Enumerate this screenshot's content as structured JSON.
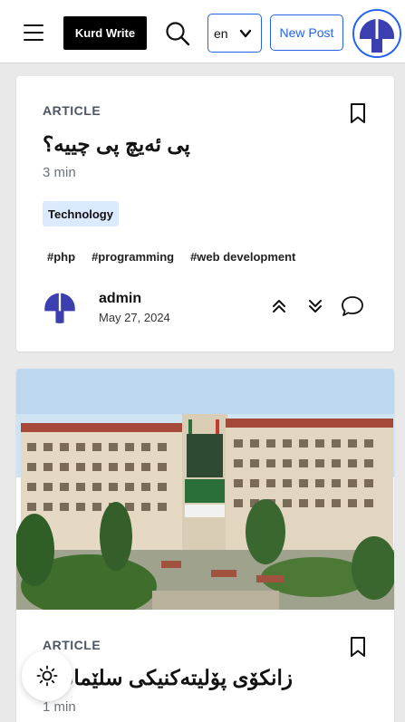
{
  "header": {
    "logo": "Kurd Write",
    "language": "en",
    "new_post_label": "New Post"
  },
  "posts": [
    {
      "kind": "ARTICLE",
      "title": "پی ئەیچ پی چییە؟",
      "read_time": "3 min",
      "category": "Technology",
      "tags": [
        "#php",
        "#programming",
        "#web development"
      ],
      "author": "admin",
      "date": "May 27, 2024"
    },
    {
      "kind": "ARTICLE",
      "title": "زانکۆی پۆلیتەکنیکی سلێمانی",
      "read_time": "1 min"
    }
  ],
  "colors": {
    "accent": "#2563eb",
    "brand_avatar": "#3b3fb0",
    "category_bg": "#dbeafe"
  },
  "icons": [
    "menu-icon",
    "search-icon",
    "chevron-down-icon",
    "bookmark-icon",
    "upvote-icon",
    "downvote-icon",
    "comment-icon",
    "sun-icon"
  ]
}
